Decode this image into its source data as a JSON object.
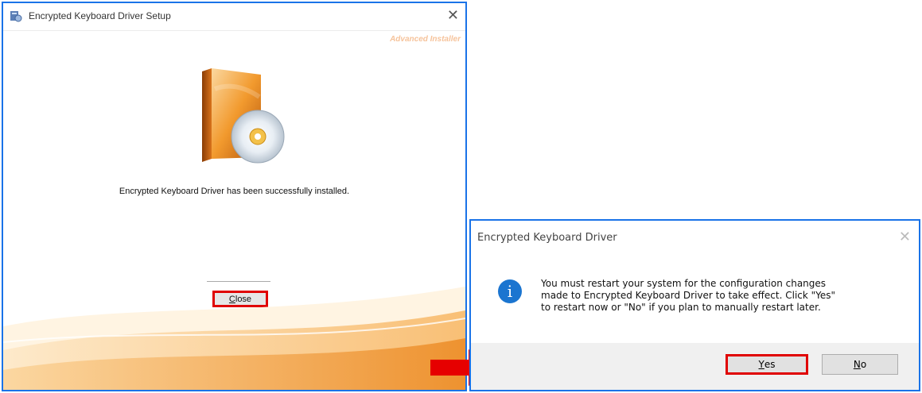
{
  "setup_window": {
    "title": "Encrypted Keyboard Driver Setup",
    "brand": "Advanced Installer",
    "success_message": "Encrypted Keyboard Driver has been successfully installed.",
    "close_button": {
      "mnemonic": "C",
      "rest": "lose"
    }
  },
  "dialog": {
    "title": "Encrypted Keyboard Driver",
    "message_lines": [
      "You must restart your system for the configuration changes",
      "made to Encrypted Keyboard Driver to take effect. Click \"Yes\"",
      "to restart now or \"No\" if you plan to manually restart later."
    ],
    "yes_button": {
      "mnemonic": "Y",
      "rest": "es"
    },
    "no_button": {
      "mnemonic": "N",
      "rest": "o"
    }
  },
  "colors": {
    "highlight": "#e00000",
    "window_border": "#1a73e8",
    "info_icon": "#1b75d0"
  }
}
